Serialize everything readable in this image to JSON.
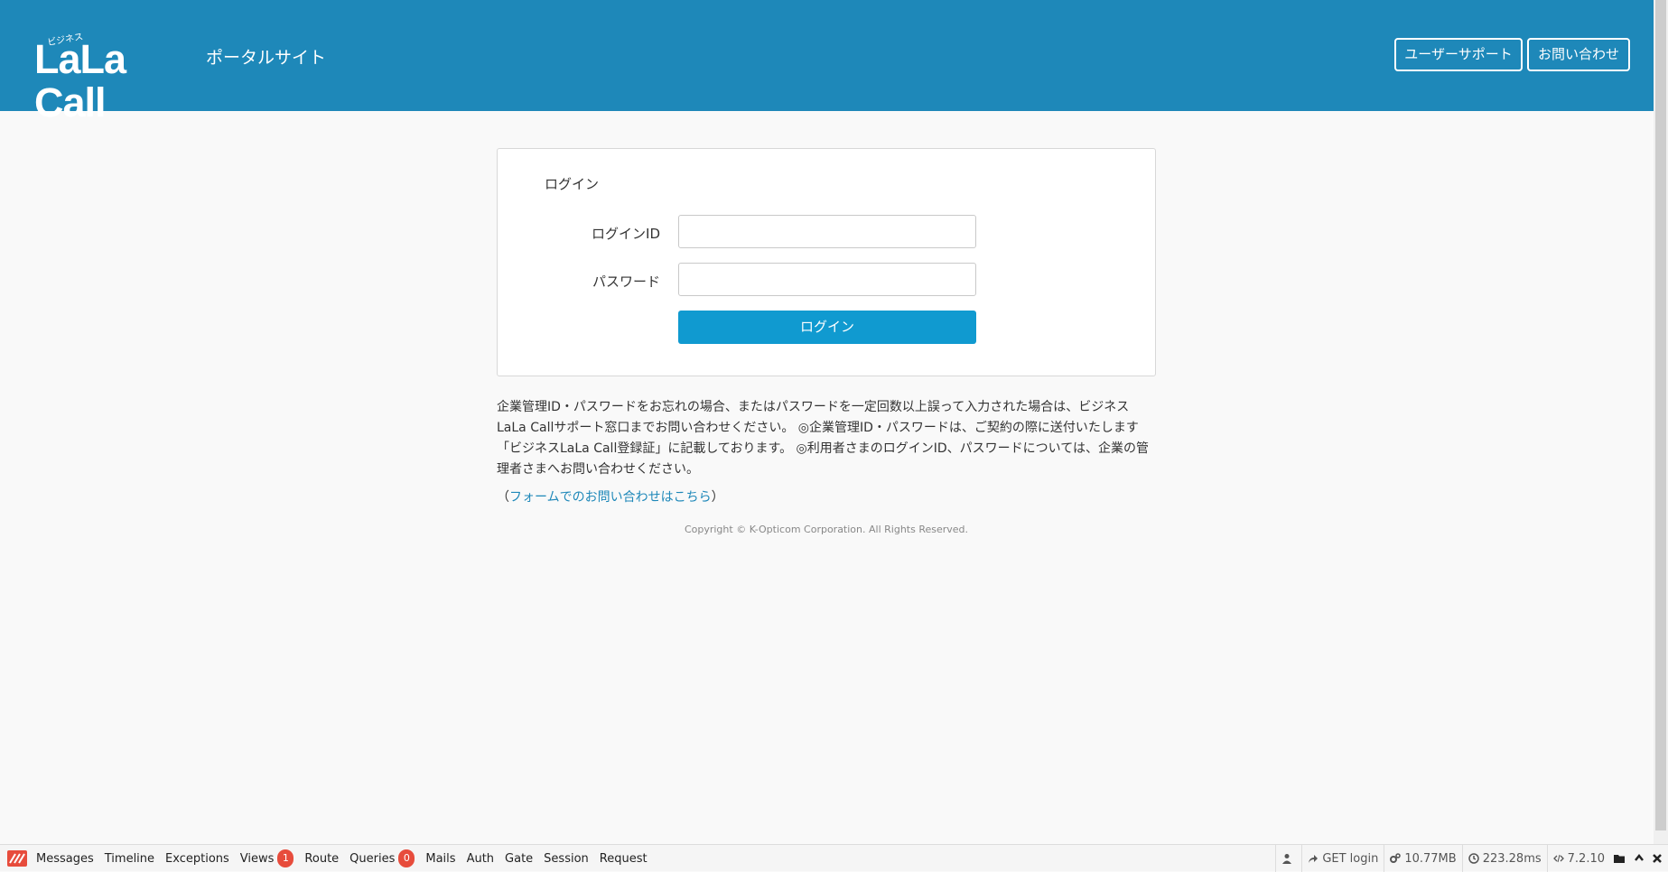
{
  "header": {
    "logo_text": "LaLa Call",
    "logo_sub": "ビジネス",
    "portal_title": "ポータルサイト",
    "support_label": "ユーザーサポート",
    "contact_label": "お問い合わせ",
    "bg_color": "#1e88b9"
  },
  "login": {
    "title": "ログイン",
    "id_label": "ログインID",
    "id_value": "",
    "password_label": "パスワード",
    "password_value": "",
    "submit_label": "ログイン",
    "button_color": "#109ad0"
  },
  "notice": {
    "text": "企業管理ID・パスワードをお忘れの場合、またはパスワードを一定回数以上誤って入力された場合は、ビジネスLaLa Callサポート窓口までお問い合わせください。 ◎企業管理ID・パスワードは、ご契約の際に送付いたします「ビジネスLaLa Call登録証」に記載しております。 ◎利用者さまのログインID、パスワードについては、企業の管理者さまへお問い合わせください。",
    "link_open": "（",
    "link_text": "フォームでのお問い合わせはこちら",
    "link_close": "）"
  },
  "footer": {
    "copyright": "Copyright © K-Opticom Corporation. All Rights Reserved."
  },
  "debugbar": {
    "tabs": [
      {
        "label": "Messages"
      },
      {
        "label": "Timeline"
      },
      {
        "label": "Exceptions"
      },
      {
        "label": "Views",
        "badge": "1"
      },
      {
        "label": "Route"
      },
      {
        "label": "Queries",
        "badge": "0"
      },
      {
        "label": "Mails"
      },
      {
        "label": "Auth"
      },
      {
        "label": "Gate"
      },
      {
        "label": "Session"
      },
      {
        "label": "Request"
      }
    ],
    "route": "GET login",
    "memory": "10.77MB",
    "time": "223.28ms",
    "php_version": "7.2.10",
    "badge_color": "#e74c3c"
  }
}
